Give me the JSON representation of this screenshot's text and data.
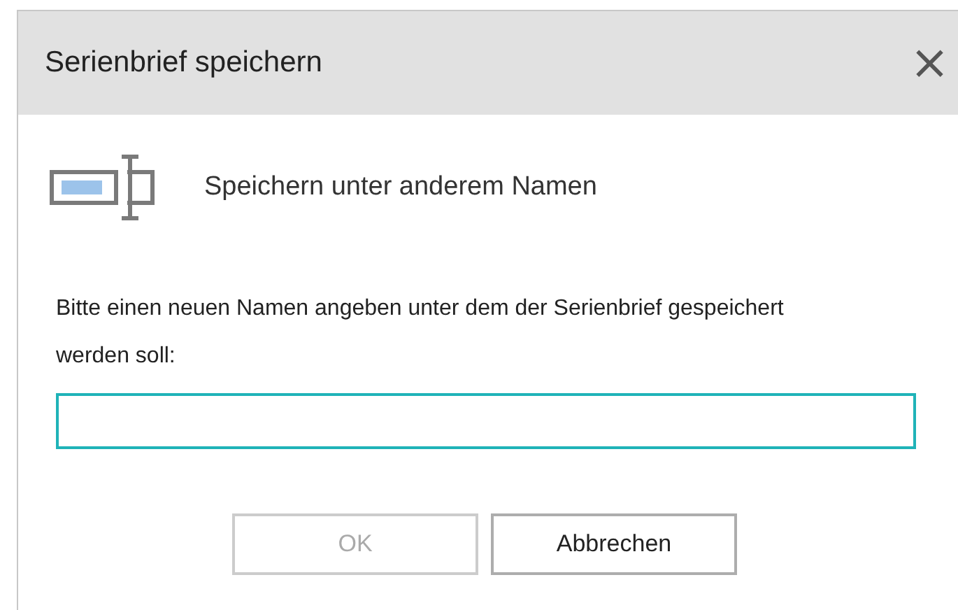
{
  "window": {
    "title": "Serienbrief speichern",
    "close": "×"
  },
  "heading": "Speichern unter anderem Namen",
  "prompt": "Bitte einen neuen Namen angeben unter dem der Serienbrief gespeichert werden soll:",
  "name_field": {
    "focused": true
  },
  "buttons": [
    {
      "label": "OK",
      "disabled": true
    },
    {
      "label": "Abbrechen",
      "disabled": false
    }
  ]
}
